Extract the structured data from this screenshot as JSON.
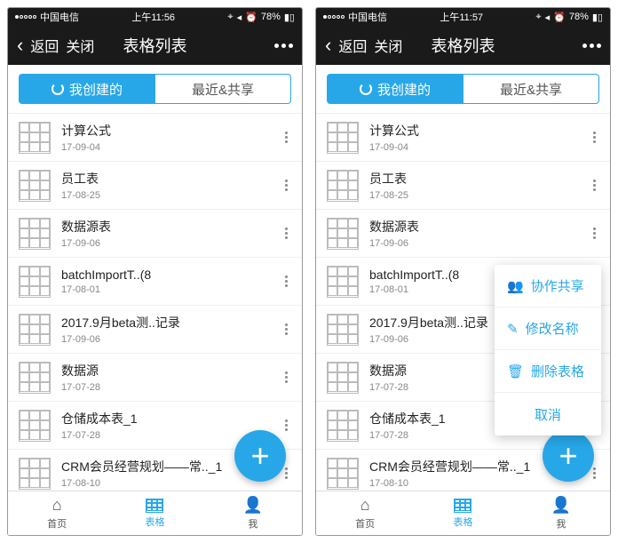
{
  "phones": [
    {
      "status": {
        "carrier": "中国电信",
        "time": "上午11:56",
        "battery": "78%"
      },
      "nav": {
        "back": "返回",
        "close": "关闭",
        "title": "表格列表"
      },
      "tabs": {
        "active": "我创建的",
        "inactive": "最近&共享"
      },
      "items": [
        {
          "title": "计算公式",
          "date": "17-09-04"
        },
        {
          "title": "员工表",
          "date": "17-08-25"
        },
        {
          "title": "数据源表",
          "date": "17-09-06"
        },
        {
          "title": "batchImportT..(8",
          "date": "17-08-01"
        },
        {
          "title": "2017.9月beta测..记录",
          "date": "17-09-06"
        },
        {
          "title": "数据源",
          "date": "17-07-28"
        },
        {
          "title": "仓储成本表_1",
          "date": "17-07-28"
        },
        {
          "title": "CRM会员经营规划——常.._1",
          "date": "17-08-10"
        }
      ],
      "bottom": {
        "home": "首页",
        "tables": "表格",
        "me": "我"
      }
    },
    {
      "status": {
        "carrier": "中国电信",
        "time": "上午11:57",
        "battery": "78%"
      },
      "nav": {
        "back": "返回",
        "close": "关闭",
        "title": "表格列表"
      },
      "tabs": {
        "active": "我创建的",
        "inactive": "最近&共享"
      },
      "items": [
        {
          "title": "计算公式",
          "date": "17-09-04"
        },
        {
          "title": "员工表",
          "date": "17-08-25"
        },
        {
          "title": "数据源表",
          "date": "17-09-06"
        },
        {
          "title": "batchImportT..(8",
          "date": "17-08-01"
        },
        {
          "title": "2017.9月beta测..记录",
          "date": "17-09-06"
        },
        {
          "title": "数据源",
          "date": "17-07-28"
        },
        {
          "title": "仓储成本表_1",
          "date": "17-07-28"
        },
        {
          "title": "CRM会员经营规划——常.._1",
          "date": "17-08-10"
        }
      ],
      "popup": [
        {
          "icon": "👥",
          "label": "协作共享"
        },
        {
          "icon": "✎",
          "label": "修改名称"
        },
        {
          "icon": "🗑",
          "label": "删除表格"
        },
        {
          "icon": "",
          "label": "取消"
        }
      ],
      "bottom": {
        "home": "首页",
        "tables": "表格",
        "me": "我"
      }
    }
  ]
}
